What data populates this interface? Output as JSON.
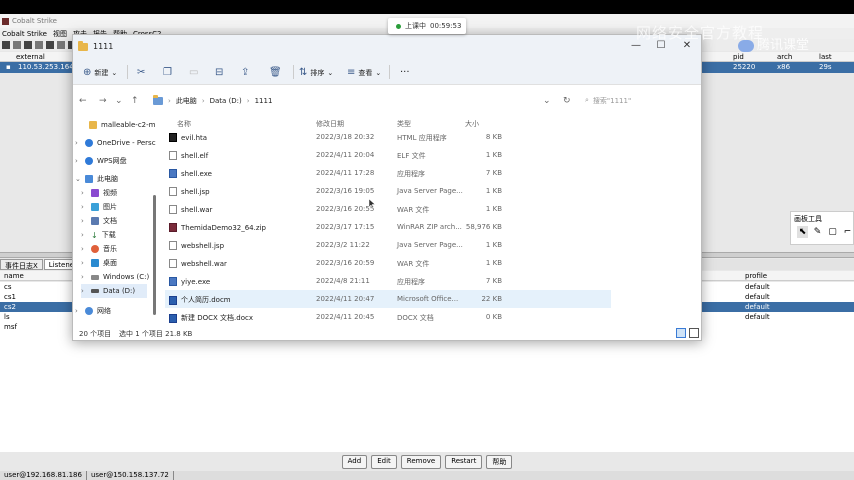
{
  "recording": {
    "status": "上课中",
    "time": "00:59:53"
  },
  "watermark": {
    "text": "网络安全官方教程",
    "logo": "腾讯课堂"
  },
  "cobalt": {
    "title": "Cobalt Strike",
    "menu": [
      "Cobalt Strike",
      "视图",
      "攻击",
      "报告",
      "帮助",
      "CrossC2"
    ],
    "beacon_headers": {
      "external": "external",
      "pid": "pid",
      "arch": "arch",
      "last": "last"
    },
    "beacon_row": {
      "external": "110.53.253.164",
      "pid": "25220",
      "arch": "x86",
      "last": "29s"
    },
    "tabs": [
      "事件日志X",
      "Listeners"
    ],
    "list_headers": {
      "name": "name",
      "profile": "profile"
    },
    "listeners": [
      {
        "name": "cs",
        "profile": "default"
      },
      {
        "name": "cs1",
        "profile": "default"
      },
      {
        "name": "cs2",
        "profile": "default"
      },
      {
        "name": "ls",
        "profile": "default"
      },
      {
        "name": "msf",
        "profile": ""
      }
    ],
    "buttons": [
      "Add",
      "Edit",
      "Remove",
      "Restart",
      "帮助"
    ],
    "status": [
      "user@192.168.81.186",
      "user@150.158.137.72"
    ]
  },
  "draw_panel": {
    "title": "画板工具"
  },
  "explorer": {
    "title": "1111",
    "cmd": {
      "new": "新建",
      "sort": "排序",
      "view": "查看"
    },
    "path": [
      "此电脑",
      "Data (D:)",
      "1111"
    ],
    "search_placeholder": "搜索\"1111\"",
    "nav": [
      "malleable-c2-m",
      "OneDrive - Persc",
      "WPS网盘",
      "此电脑",
      "视频",
      "图片",
      "文档",
      "下载",
      "音乐",
      "桌面",
      "Windows (C:)",
      "Data (D:)",
      "网络"
    ],
    "columns": {
      "name": "名称",
      "date": "修改日期",
      "type": "类型",
      "size": "大小"
    },
    "files": [
      {
        "name": "evil.hta",
        "date": "2022/3/18 20:32",
        "type": "HTML 应用程序",
        "size": "8 KB",
        "icon": "hta"
      },
      {
        "name": "shell.elf",
        "date": "2022/4/11 20:04",
        "type": "ELF 文件",
        "size": "1 KB",
        "icon": "file"
      },
      {
        "name": "shell.exe",
        "date": "2022/4/11 17:28",
        "type": "应用程序",
        "size": "7 KB",
        "icon": "exe"
      },
      {
        "name": "shell.jsp",
        "date": "2022/3/16 19:05",
        "type": "Java Server Page...",
        "size": "1 KB",
        "icon": "file"
      },
      {
        "name": "shell.war",
        "date": "2022/3/16 20:55",
        "type": "WAR 文件",
        "size": "1 KB",
        "icon": "file"
      },
      {
        "name": "ThemidaDemo32_64.zip",
        "date": "2022/3/17 17:15",
        "type": "WinRAR ZIP arch...",
        "size": "58,976 KB",
        "icon": "zip"
      },
      {
        "name": "webshell.jsp",
        "date": "2022/3/2 11:22",
        "type": "Java Server Page...",
        "size": "1 KB",
        "icon": "file"
      },
      {
        "name": "webshell.war",
        "date": "2022/3/16 20:59",
        "type": "WAR 文件",
        "size": "1 KB",
        "icon": "file"
      },
      {
        "name": "yiye.exe",
        "date": "2022/4/8 21:11",
        "type": "应用程序",
        "size": "7 KB",
        "icon": "exe"
      },
      {
        "name": "个人简历.docm",
        "date": "2022/4/11 20:47",
        "type": "Microsoft Office...",
        "size": "22 KB",
        "icon": "doc"
      },
      {
        "name": "新建 DOCX 文档.docx",
        "date": "2022/4/11 20:45",
        "type": "DOCX 文档",
        "size": "0 KB",
        "icon": "doc"
      }
    ],
    "status": {
      "count": "20 个项目",
      "selected": "选中 1 个项目  21.8 KB"
    }
  }
}
